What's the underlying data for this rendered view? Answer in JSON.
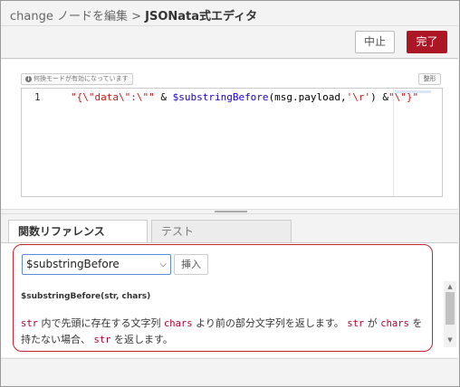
{
  "header": {
    "crumb_prefix": "change ノードを編集 > ",
    "crumb_title": "JSONata式エディタ"
  },
  "toolbar": {
    "cancel_label": "中止",
    "done_label": "完了"
  },
  "editor": {
    "mode_badge": "何換モードが有効になっています",
    "format_label": "整形",
    "line_number": "1",
    "code_tokens": {
      "t1": "\"{\\\"data\\\":\\\"\"",
      "t2": " & ",
      "t3": "$substringBefore",
      "t4": "(msg.payload,",
      "t5": "'\\r'",
      "t6": ") &",
      "t7": "\"\\\"}\""
    }
  },
  "tabs": {
    "reference": "関数リファレンス",
    "test": "テスト"
  },
  "reference": {
    "selected_function": "$substringBefore",
    "insert_label": "挿入",
    "signature": "$substringBefore(str, chars)",
    "desc": {
      "c1": "str",
      "p1": " 内で先頭に存在する文字列 ",
      "c2": "chars",
      "p2": " より前の部分文字列を返します。 ",
      "c3": "str",
      "p3": " が ",
      "c4": "chars",
      "p4": " を持たない場合、 ",
      "c5": "str",
      "p5": " を返します。"
    }
  },
  "colors": {
    "accent": "#ad1625",
    "highlight": "#c8232c",
    "code_arg": "#b4002d"
  }
}
